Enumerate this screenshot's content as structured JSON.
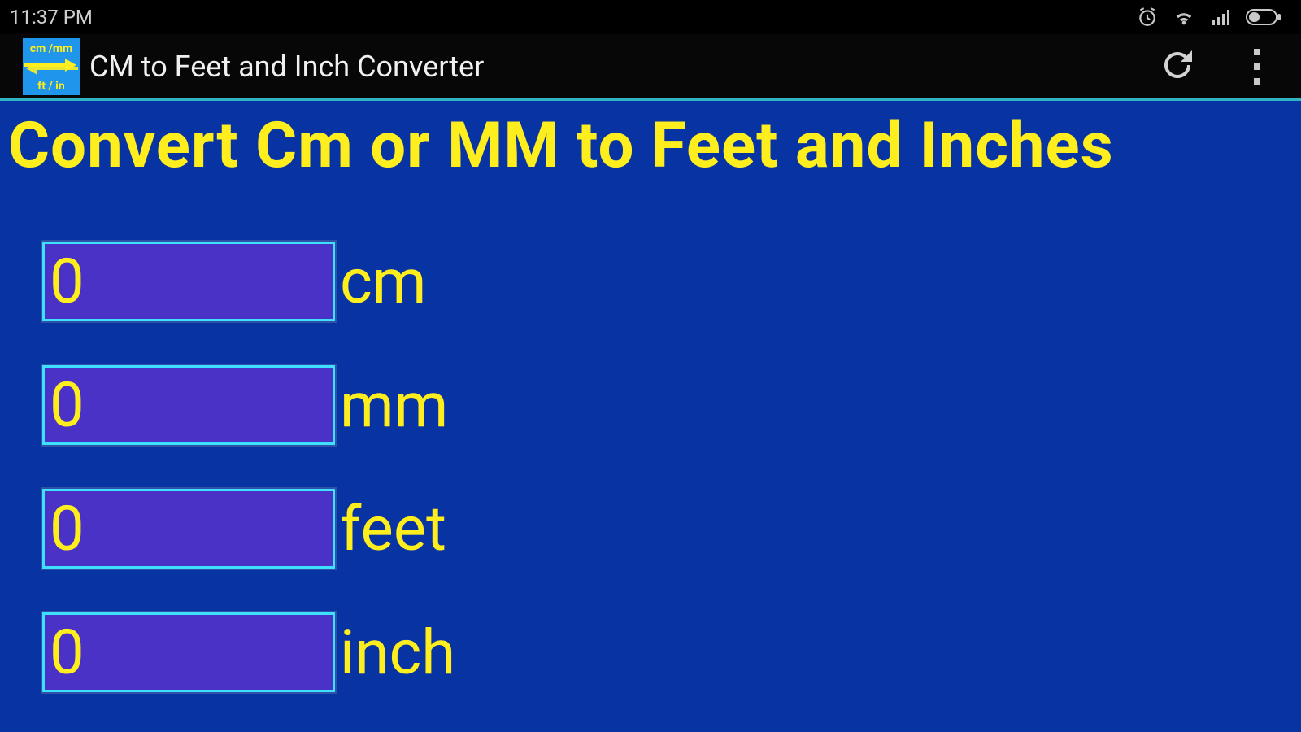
{
  "statusbar": {
    "time": "11:37 PM"
  },
  "actionbar": {
    "title": "CM to Feet and Inch Converter",
    "icon_top": "cm /mm",
    "icon_bottom": "ft / in"
  },
  "heading": "Convert Cm or MM to Feet and Inches",
  "fields": {
    "cm": {
      "value": "0",
      "label": "cm"
    },
    "mm": {
      "value": "0",
      "label": "mm"
    },
    "feet": {
      "value": "0",
      "label": "feet"
    },
    "inch": {
      "value": "0",
      "label": "inch"
    }
  },
  "icons": {
    "alarm": "alarm-icon",
    "wifi": "wifi-icon",
    "signal": "signal-icon",
    "battery": "battery-icon",
    "refresh": "refresh-icon",
    "overflow": "overflow-menu-icon"
  }
}
